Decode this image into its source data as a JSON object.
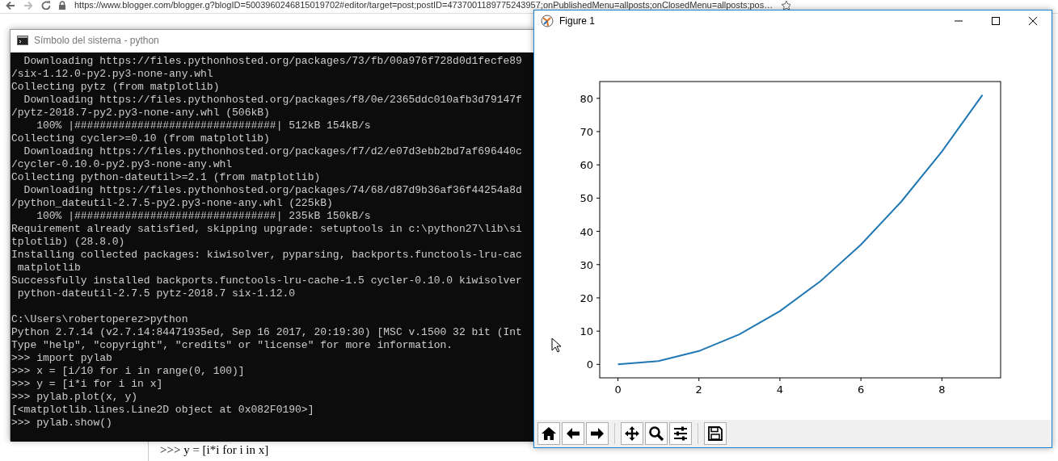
{
  "browser": {
    "url": "https://www.blogger.com/blogger.g?blogID=5003960246815019702#editor/target=post;postID=4737001189775243957;onPublishedMenu=allposts;onClosedMenu=allposts;pos…"
  },
  "editor_behind": {
    "lines": [
      ">>> y = [i*i for i in x]"
    ]
  },
  "console": {
    "title": "Símbolo del sistema - python",
    "blocks": [
      [
        "  Downloading https://files.pythonhosted.org/packages/73/fb/00a976f728d0d1fecfe89",
        "/six-1.12.0-py2.py3-none-any.whl",
        "Collecting pytz (from matplotlib)",
        "  Downloading https://files.pythonhosted.org/packages/f8/0e/2365ddc010afb3d79147f",
        "/pytz-2018.7-py2.py3-none-any.whl (506kB)",
        "    100% |################################| 512kB 154kB/s",
        "Collecting cycler>=0.10 (from matplotlib)",
        "  Downloading https://files.pythonhosted.org/packages/f7/d2/e07d3ebb2bd7af696440c",
        "/cycler-0.10.0-py2.py3-none-any.whl",
        "Collecting python-dateutil>=2.1 (from matplotlib)",
        "  Downloading https://files.pythonhosted.org/packages/74/68/d87d9b36af36f44254a8d",
        "/python_dateutil-2.7.5-py2.py3-none-any.whl (225kB)",
        "    100% |################################| 235kB 150kB/s",
        "Requirement already satisfied, skipping upgrade: setuptools in c:\\python27\\lib\\si",
        "tplotlib) (28.8.0)",
        "Installing collected packages: kiwisolver, pyparsing, backports.functools-lru-cac",
        " matplotlib",
        "Successfully installed backports.functools-lru-cache-1.5 cycler-0.10.0 kiwisolver",
        " python-dateutil-2.7.5 pytz-2018.7 six-1.12.0"
      ],
      [
        "C:\\Users\\robertoperez>python",
        "Python 2.7.14 (v2.7.14:84471935ed, Sep 16 2017, 20:19:30) [MSC v.1500 32 bit (Int",
        "Type \"help\", \"copyright\", \"credits\" or \"license\" for more information.",
        ">>> import pylab",
        ">>> x = [i/10 for i in range(0, 100)]",
        ">>> y = [i*i for i in x]",
        ">>> pylab.plot(x, y)",
        "[<matplotlib.lines.Line2D object at 0x082F0190>]",
        ">>> pylab.show()"
      ]
    ]
  },
  "figure": {
    "title": "Figure 1",
    "selected": true,
    "chart_data": {
      "type": "line",
      "x": [
        0,
        1,
        2,
        3,
        4,
        5,
        6,
        7,
        8,
        9
      ],
      "series": [
        {
          "color": "#1f77b4",
          "values": [
            0,
            1,
            4,
            9,
            16,
            25,
            36,
            49,
            64,
            81
          ]
        }
      ],
      "xlim": [
        -0.45,
        9.45
      ],
      "ylim": [
        -4.05,
        85.05
      ],
      "xticks": [
        0,
        2,
        4,
        6,
        8
      ],
      "yticks": [
        0,
        10,
        20,
        30,
        40,
        50,
        60,
        70,
        80
      ]
    },
    "toolbar": [
      {
        "kind": "home"
      },
      {
        "kind": "back"
      },
      {
        "kind": "forward"
      },
      {
        "kind": "separator"
      },
      {
        "kind": "pan"
      },
      {
        "kind": "zoom"
      },
      {
        "kind": "configure"
      },
      {
        "kind": "separator"
      },
      {
        "kind": "save"
      }
    ]
  }
}
